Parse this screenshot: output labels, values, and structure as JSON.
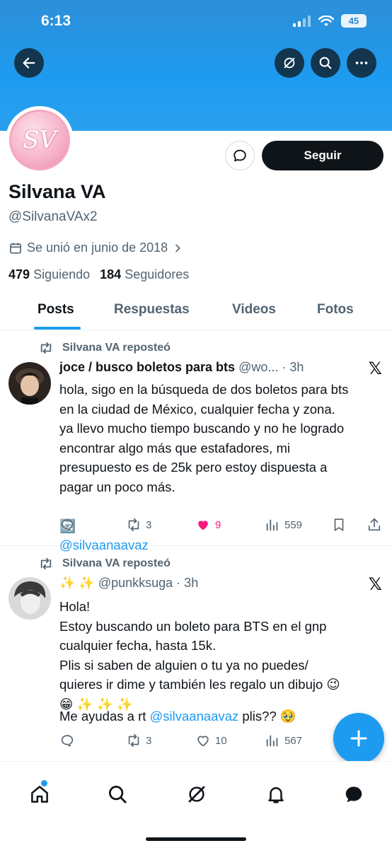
{
  "status_bar": {
    "time": "6:13",
    "battery": "45"
  },
  "profile": {
    "name": "Silvana VA",
    "handle": "@SilvanaVAx2",
    "avatar_text": "SV",
    "joined": "Se unió en junio de 2018",
    "following_count": "479",
    "following_label": "Siguiendo",
    "followers_count": "184",
    "followers_label": "Seguidores",
    "follow_label": "Seguir"
  },
  "tabs": [
    "Posts",
    "Respuestas",
    "Videos",
    "Fotos"
  ],
  "posts": [
    {
      "repost_label": "Silvana VA reposteó",
      "author": "joce / busco boletos para bts",
      "meta": "@wo... · 3h",
      "text": "hola, sigo en la búsqueda de dos boletos para bts\nen la ciudad de México, cualquier fecha y zona.\nya llevo mucho tiempo buscando y no he logrado\nencontrar algo más que estafadores, mi\npresupuesto es de 25k pero estoy dispuesta a\npagar un poco más.",
      "emoji": "🔄",
      "mention": "@silvaanaavaz",
      "reposts": "3",
      "likes": "9",
      "views": "559"
    },
    {
      "repost_label": "Silvana VA reposteó",
      "author": "✨ ✨",
      "meta": "@punkksuga · 3h",
      "text": "Hola!\nEstoy buscando un boleto para BTS en el gnp\ncualquier fecha, hasta 15k.\nPlis si saben de alguien o tu ya no puedes/\nquieres ir dime y también les regalo un dibujo 😉\n😁 ✨ ✨ ✨",
      "last_line_prefix": "Me ayudas a rt ",
      "mention": "@silvaanaavaz",
      "last_line_suffix": " plis?? 🥹",
      "reposts": "3",
      "likes": "10",
      "views": "567"
    }
  ],
  "colors": {
    "accent": "#1d9bf0",
    "like": "#f91880",
    "header": "#1d9bf0"
  },
  "icons": [
    "back-arrow-icon",
    "grok-icon",
    "search-icon",
    "more-icon",
    "message-icon",
    "calendar-icon",
    "repost-icon",
    "x-logo-icon",
    "reply-icon",
    "heart-icon",
    "views-icon",
    "bookmark-icon",
    "share-icon",
    "plus-icon",
    "home-icon",
    "bell-icon",
    "chat-icon"
  ]
}
